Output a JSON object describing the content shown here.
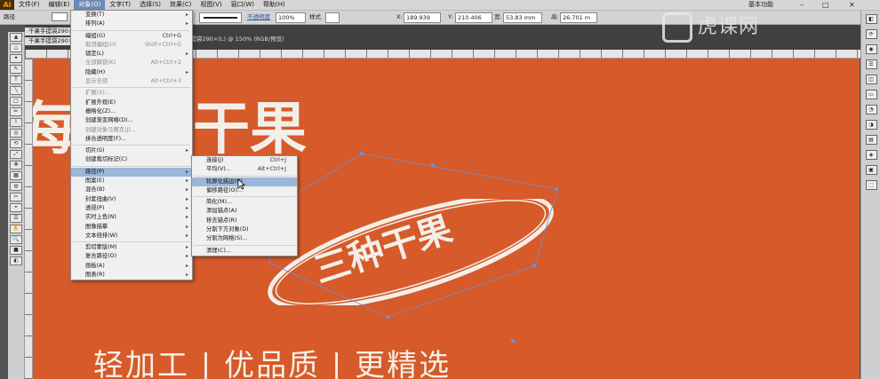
{
  "app": {
    "logo": "Ai",
    "workspace": "基本功能",
    "window_controls": [
      "–",
      "□",
      "✕"
    ]
  },
  "menubar": [
    "文件(F)",
    "编辑(E)",
    "对象(O)",
    "文字(T)",
    "选择(S)",
    "效果(C)",
    "视图(V)",
    "窗口(W)",
    "帮助(H)"
  ],
  "control_bar": {
    "selection_label": "路径",
    "opacity_label": "不透明度",
    "opacity_value": "100%",
    "style_label": "样式",
    "x_label": "X:",
    "x_value": "189.939",
    "y_label": "Y:",
    "y_value": "210.406",
    "w_label": "宽:",
    "w_value": "53.83 mm",
    "h_label": "高:",
    "h_value": "26.701 m"
  },
  "document": {
    "tab1": "千果手提袋290×",
    "tab2": "千果手提袋290×1",
    "title": "千果手提袋290×(L) @ 150% (RGB/预览)"
  },
  "artwork": {
    "headline": "每一点干果",
    "badge": "三种干果",
    "slogan": "轻加工 | 优品质 | 更精选",
    "bg_color": "#d65a2a"
  },
  "object_menu": [
    {
      "label": "变换(T)",
      "arrow": true
    },
    {
      "label": "排列(A)",
      "arrow": true
    },
    {
      "sep": true
    },
    {
      "label": "编组(G)",
      "shortcut": "Ctrl+G"
    },
    {
      "label": "取消编组(U)",
      "shortcut": "Shift+Ctrl+G",
      "disabled": true
    },
    {
      "label": "锁定(L)",
      "arrow": true
    },
    {
      "label": "全部解锁(K)",
      "shortcut": "Alt+Ctrl+2",
      "disabled": true
    },
    {
      "label": "隐藏(H)",
      "arrow": true
    },
    {
      "label": "显示全部",
      "shortcut": "Alt+Ctrl+3",
      "disabled": true
    },
    {
      "sep": true
    },
    {
      "label": "扩展(X)...",
      "disabled": true
    },
    {
      "label": "扩展外观(E)"
    },
    {
      "label": "栅格化(Z)..."
    },
    {
      "label": "创建渐变网格(D)..."
    },
    {
      "label": "创建对象马赛克(J)...",
      "disabled": true
    },
    {
      "label": "拼合透明度(F)..."
    },
    {
      "sep": true
    },
    {
      "label": "切片(S)",
      "arrow": true
    },
    {
      "label": "创建裁切标记(C)"
    },
    {
      "sep": true
    },
    {
      "label": "路径(P)",
      "arrow": true,
      "highlight": true
    },
    {
      "label": "图案(E)",
      "arrow": true
    },
    {
      "label": "混合(B)",
      "arrow": true
    },
    {
      "label": "封套扭曲(V)",
      "arrow": true
    },
    {
      "label": "透视(P)",
      "arrow": true
    },
    {
      "label": "实时上色(N)",
      "arrow": true
    },
    {
      "label": "图像描摹",
      "arrow": true
    },
    {
      "label": "文本绕排(W)",
      "arrow": true
    },
    {
      "sep": true
    },
    {
      "label": "剪切蒙版(M)",
      "arrow": true
    },
    {
      "label": "复合路径(O)",
      "arrow": true
    },
    {
      "label": "画板(A)",
      "arrow": true
    },
    {
      "label": "图表(R)",
      "arrow": true
    }
  ],
  "path_submenu": [
    {
      "label": "连接(J)",
      "shortcut": "Ctrl+J"
    },
    {
      "label": "平均(V)...",
      "shortcut": "Alt+Ctrl+J"
    },
    {
      "sep": true
    },
    {
      "label": "轮廓化描边(U)",
      "highlight": true
    },
    {
      "label": "偏移路径(O)..."
    },
    {
      "sep": true
    },
    {
      "label": "简化(M)..."
    },
    {
      "label": "添加锚点(A)"
    },
    {
      "label": "移去锚点(R)"
    },
    {
      "label": "分割下方对象(D)"
    },
    {
      "label": "分割为网格(S)..."
    },
    {
      "sep": true
    },
    {
      "label": "清理(C)..."
    }
  ],
  "watermark": "虎课网"
}
